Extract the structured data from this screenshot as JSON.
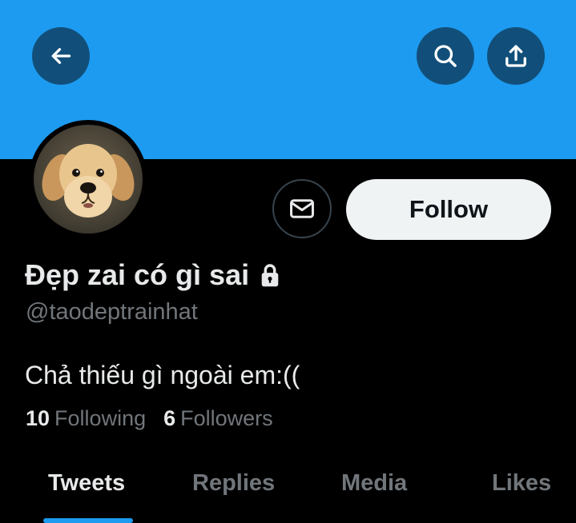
{
  "header": {
    "back_icon": "arrow-left-icon",
    "search_icon": "search-icon",
    "share_icon": "share-upload-icon",
    "banner_color": "#1d9bf0",
    "button_bg_color": "#114f7a"
  },
  "profile": {
    "avatar_description_icon": "avatar-puppy-image",
    "message_icon": "envelope-icon",
    "follow_label": "Follow",
    "display_name": "Đẹp zai có gì sai",
    "protected_icon": "lock-icon",
    "handle": "@taodeptrainhat",
    "bio": "Chả thiếu gì ngoài em:(("
  },
  "stats": {
    "following_count": "10",
    "following_label": "Following",
    "followers_count": "6",
    "followers_label": "Followers"
  },
  "tabs": [
    {
      "label": "Tweets",
      "active": true
    },
    {
      "label": "Replies",
      "active": false
    },
    {
      "label": "Media",
      "active": false
    },
    {
      "label": "Likes",
      "active": false
    }
  ],
  "colors": {
    "accent": "#1d9bf0",
    "background": "#000000",
    "primary_text": "#e7e9ea",
    "secondary_text": "#71767b"
  }
}
